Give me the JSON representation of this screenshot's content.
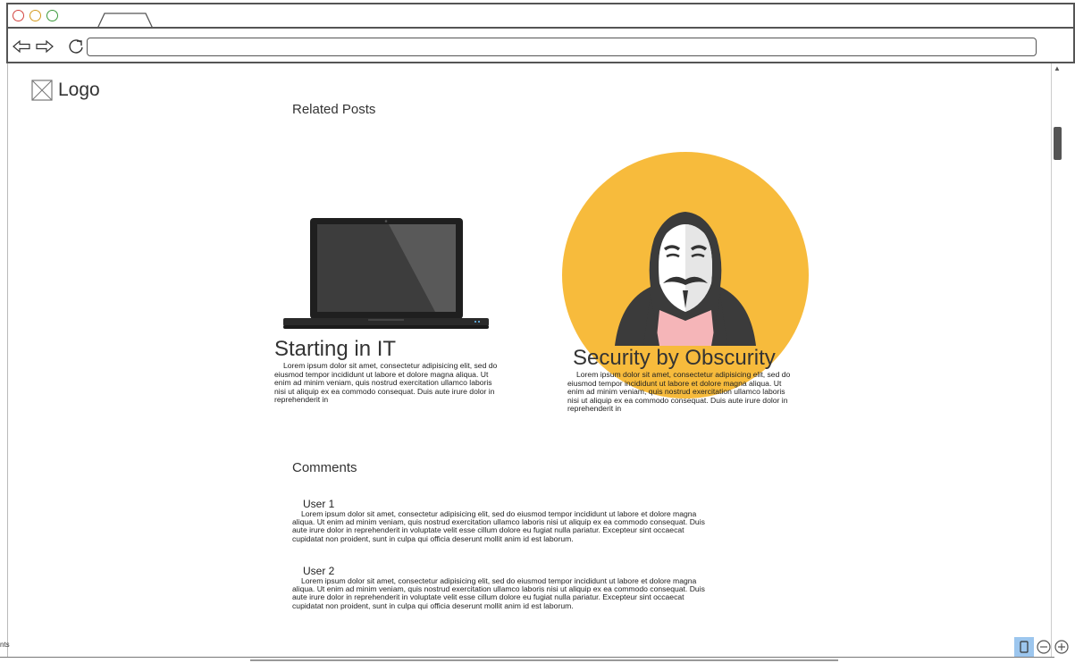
{
  "browser": {
    "address_value": ""
  },
  "header": {
    "logo_text": "Logo"
  },
  "related": {
    "title": "Related Posts",
    "posts": [
      {
        "title": "Starting in IT",
        "body": "Lorem ipsum dolor sit amet, consectetur adipisicing elit, sed do eiusmod tempor incididunt ut labore et dolore magna aliqua. Ut enim ad minim veniam, quis nostrud exercitation ullamco laboris nisi ut aliquip ex ea commodo consequat. Duis aute irure dolor in reprehenderit in",
        "image": "laptop"
      },
      {
        "title": "Security by Obscurity",
        "body": "Lorem ipsum dolor sit amet, consectetur adipisicing elit, sed do eiusmod tempor incididunt ut labore et dolore magna aliqua. Ut enim ad minim veniam, quis nostrud exercitation ullamco laboris nisi ut aliquip ex ea commodo consequat. Duis aute irure dolor in reprehenderit in",
        "image": "hooded-hacker-mask"
      }
    ]
  },
  "comments": {
    "title": "Comments",
    "items": [
      {
        "user": "User 1",
        "body": "Lorem ipsum dolor sit amet, consectetur adipisicing elit, sed do eiusmod tempor incididunt ut labore et dolore magna aliqua. Ut enim ad minim veniam, quis nostrud exercitation ullamco laboris nisi ut aliquip ex ea commodo consequat. Duis aute irure dolor in reprehenderit in voluptate velit esse cillum dolore eu fugiat nulla pariatur. Excepteur sint occaecat cupidatat non proident, sunt in culpa qui officia deserunt mollit anim id est laborum."
      },
      {
        "user": "User 2",
        "body": "Lorem ipsum dolor sit amet, consectetur adipisicing elit, sed do eiusmod tempor incididunt ut labore et dolore magna aliqua. Ut enim ad minim veniam, quis nostrud exercitation ullamco laboris nisi ut aliquip ex ea commodo consequat. Duis aute irure dolor in reprehenderit in voluptate velit esse cillum dolore eu fugiat nulla pariatur. Excepteur sint occaecat cupidatat non proident, sunt in culpa qui officia deserunt mollit anim id est laborum."
      }
    ]
  },
  "status_bar": {
    "text": "nts"
  },
  "colors": {
    "accent_circle": "#f7bb3c",
    "zoom_active": "#9cc6ee",
    "chrome_border": "#555555"
  },
  "icons": {
    "back": "arrow-left-icon",
    "forward": "arrow-right-icon",
    "reload": "reload-icon",
    "logo": "image-placeholder-icon",
    "mobile": "mobile-device-icon",
    "zoom_out": "zoom-out-icon",
    "zoom_in": "zoom-in-icon"
  }
}
